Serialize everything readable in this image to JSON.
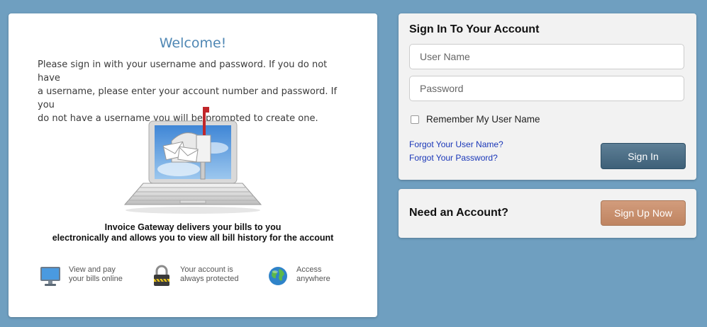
{
  "welcome": {
    "title": "Welcome!",
    "lines": [
      "Please sign in with your username and password.  If you do not have",
      "a username, please enter your account number and password. If you",
      "do not have a username you will be prompted to create one."
    ],
    "tagline": [
      "Invoice Gateway delivers your bills to you",
      "electronically and allows you to view all bill history for the account"
    ],
    "features": [
      {
        "icon": "monitor-icon",
        "line1": "View and pay",
        "line2": "your bills online"
      },
      {
        "icon": "padlock-icon",
        "line1": "Your account is",
        "line2": "always protected"
      },
      {
        "icon": "globe-icon",
        "line1": "Access",
        "line2": "anywhere"
      }
    ]
  },
  "signin": {
    "title": "Sign In To Your Account",
    "username_placeholder": "User Name",
    "password_placeholder": "Password",
    "remember_label": "Remember My User Name",
    "remember_checked": false,
    "forgot_username": "Forgot Your User Name?",
    "forgot_password": "Forgot Your Password?",
    "button": "Sign In"
  },
  "account": {
    "title": "Need an Account?",
    "button": "Sign Up Now"
  },
  "colors": {
    "background": "#6f9fc0",
    "title_blue": "#4f87b4",
    "link": "#1a37b8",
    "signin_button": "#4a6b82",
    "signup_button": "#c98f6d"
  }
}
